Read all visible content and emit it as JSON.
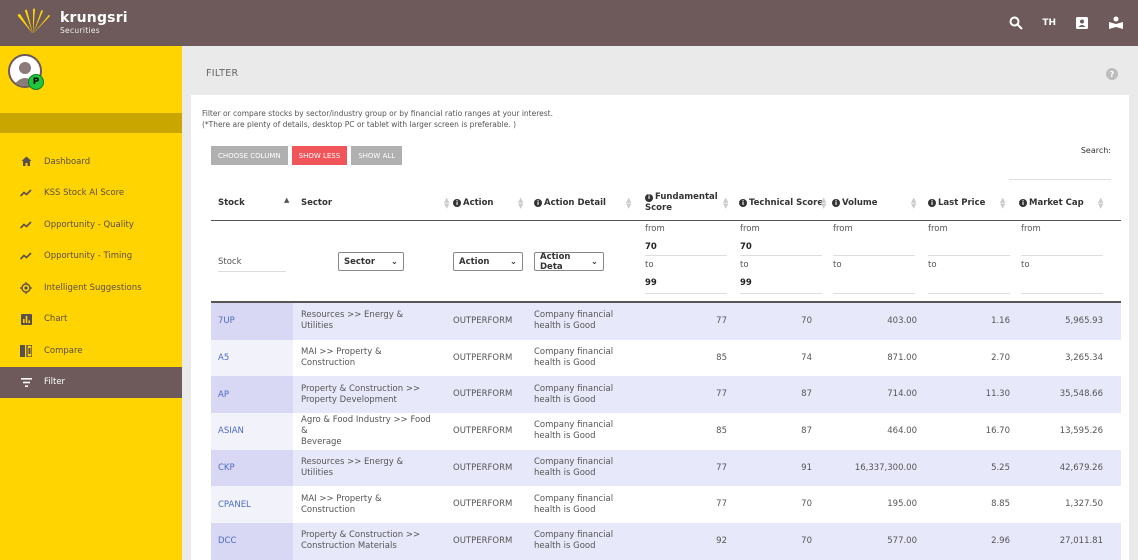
{
  "brand": {
    "name": "krungsri",
    "sub": "Securities"
  },
  "topbar": {
    "lang": "TH"
  },
  "sidebar": {
    "avatar_badge": "P",
    "items": [
      {
        "label": "Dashboard",
        "icon": "home-icon",
        "active": false
      },
      {
        "label": "KSS Stock AI Score",
        "icon": "trend-icon",
        "active": false
      },
      {
        "label": "Opportunity - Quality",
        "icon": "trend-icon",
        "active": false
      },
      {
        "label": "Opportunity - Timing",
        "icon": "trend-icon",
        "active": false
      },
      {
        "label": "Intelligent Suggestions",
        "icon": "target-icon",
        "active": false
      },
      {
        "label": "Chart",
        "icon": "bar-chart-icon",
        "active": false
      },
      {
        "label": "Compare",
        "icon": "compare-icon",
        "active": false
      },
      {
        "label": "Filter",
        "icon": "filter-icon",
        "active": true
      }
    ]
  },
  "page": {
    "title": "FILTER",
    "intro_line1": "Filter or compare stocks by sector/industry group or by financial ratio ranges at your interest.",
    "intro_line2": "(*There are plenty of details, desktop PC or tablet with larger screen is preferable. )",
    "buttons": {
      "choose_column": "CHOOSE COLUMN",
      "show_less": "SHOW LESS",
      "show_all": "SHOW ALL"
    },
    "search_label": "Search:"
  },
  "table": {
    "headers": {
      "stock": "Stock",
      "sector": "Sector",
      "action": "Action",
      "action_detail": "Action Detail",
      "fundamental_1": "Fundamental",
      "fundamental_2": "Score",
      "technical": "Technical Score",
      "volume": "Volume",
      "last_price": "Last Price",
      "market_cap": "Market Cap"
    },
    "filters": {
      "stock_placeholder": "Stock",
      "sector_select": "Sector",
      "action_select": "Action",
      "action_detail_select": "Action Deta",
      "from": "from",
      "to": "to",
      "fundamental_from": "70",
      "fundamental_to": "99",
      "technical_from": "70",
      "technical_to": "99"
    },
    "rows": [
      {
        "stock": "7UP",
        "sector": "Resources >> Energy & Utilities",
        "sector2": "",
        "action": "OUTPERFORM",
        "detail1": "Company financial",
        "detail2": "health is Good",
        "fundamental": "77",
        "technical": "70",
        "volume": "403.00",
        "last_price": "1.16",
        "market_cap": "5,965.93"
      },
      {
        "stock": "A5",
        "sector": "MAI >> Property & Construction",
        "sector2": "",
        "action": "OUTPERFORM",
        "detail1": "Company financial",
        "detail2": "health is Good",
        "fundamental": "85",
        "technical": "74",
        "volume": "871.00",
        "last_price": "2.70",
        "market_cap": "3,265.34"
      },
      {
        "stock": "AP",
        "sector": "Property & Construction >>",
        "sector2": "Property Development",
        "action": "OUTPERFORM",
        "detail1": "Company financial",
        "detail2": "health is Good",
        "fundamental": "77",
        "technical": "87",
        "volume": "714.00",
        "last_price": "11.30",
        "market_cap": "35,548.66"
      },
      {
        "stock": "ASIAN",
        "sector": "Agro & Food Industry >> Food &",
        "sector2": "Beverage",
        "action": "OUTPERFORM",
        "detail1": "Company financial",
        "detail2": "health is Good",
        "fundamental": "85",
        "technical": "87",
        "volume": "464.00",
        "last_price": "16.70",
        "market_cap": "13,595.26"
      },
      {
        "stock": "CKP",
        "sector": "Resources >> Energy & Utilities",
        "sector2": "",
        "action": "OUTPERFORM",
        "detail1": "Company financial",
        "detail2": "health is Good",
        "fundamental": "77",
        "technical": "91",
        "volume": "16,337,300.00",
        "last_price": "5.25",
        "market_cap": "42,679.26"
      },
      {
        "stock": "CPANEL",
        "sector": "MAI >> Property & Construction",
        "sector2": "",
        "action": "OUTPERFORM",
        "detail1": "Company financial",
        "detail2": "health is Good",
        "fundamental": "77",
        "technical": "70",
        "volume": "195.00",
        "last_price": "8.85",
        "market_cap": "1,327.50"
      },
      {
        "stock": "DCC",
        "sector": "Property & Construction >>",
        "sector2": "Construction Materials",
        "action": "OUTPERFORM",
        "detail1": "Company financial",
        "detail2": "health is Good",
        "fundamental": "92",
        "technical": "70",
        "volume": "577.00",
        "last_price": "2.96",
        "market_cap": "27,011.81"
      }
    ]
  },
  "colors": {
    "topbar": "#6e5a5a",
    "sidebar": "#ffd400",
    "accent_red": "#f0555a",
    "link_blue": "#4e6bc4"
  }
}
